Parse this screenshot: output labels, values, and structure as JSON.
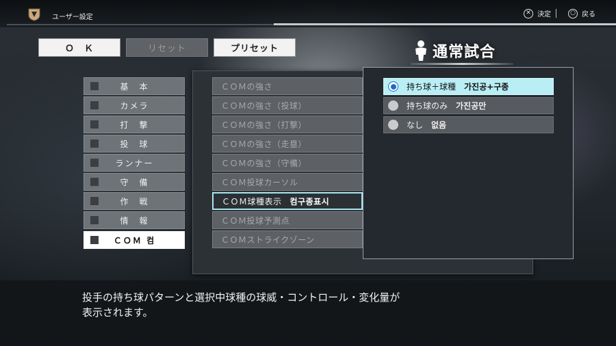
{
  "header": {
    "title": "ユーザー設定",
    "confirm_label": "決定",
    "back_label": "戻る",
    "confirm_button_glyph": "✕",
    "back_button_glyph": "○"
  },
  "top_buttons": {
    "ok": "Ｏ　Ｋ",
    "reset": "リセット",
    "preset": "プリセット"
  },
  "mode": {
    "title": "通常試合",
    "icon": "person-icon"
  },
  "categories": [
    {
      "label": "基　本"
    },
    {
      "label": "カメラ"
    },
    {
      "label": "打　撃"
    },
    {
      "label": "投　球"
    },
    {
      "label": "ランナー"
    },
    {
      "label": "守　備"
    },
    {
      "label": "作　戦"
    },
    {
      "label": "情　報"
    },
    {
      "label": "ＣＯＭ 컴"
    }
  ],
  "settings": [
    {
      "label": "ＣＯＭの強さ"
    },
    {
      "label": "ＣＯＭの強さ（投球）"
    },
    {
      "label": "ＣＯＭの強さ（打撃）"
    },
    {
      "label": "ＣＯＭの強さ（走塁）"
    },
    {
      "label": "ＣＯＭの強さ（守備）"
    },
    {
      "label": "ＣＯＭ投球カーソル"
    },
    {
      "label": "ＣＯＭ球種表示",
      "extra": "컴구종표시"
    },
    {
      "label": "ＣＯＭ投球予測点"
    },
    {
      "label": "ＣＯＭストライクゾーン"
    }
  ],
  "options": [
    {
      "label": "持ち球＋球種",
      "translation": "가진공+구종",
      "selected": true
    },
    {
      "label": "持ち球のみ",
      "translation": "가진공만",
      "selected": false
    },
    {
      "label": "なし",
      "translation": "없음",
      "selected": false
    }
  ],
  "description": {
    "line1": "投手の持ち球パターンと選択中球種の球威・コントロール・変化量が",
    "line2": "表示されます。"
  },
  "colors": {
    "accent_cyan": "#b9eef5",
    "radio_blue": "#1b6cc9"
  }
}
